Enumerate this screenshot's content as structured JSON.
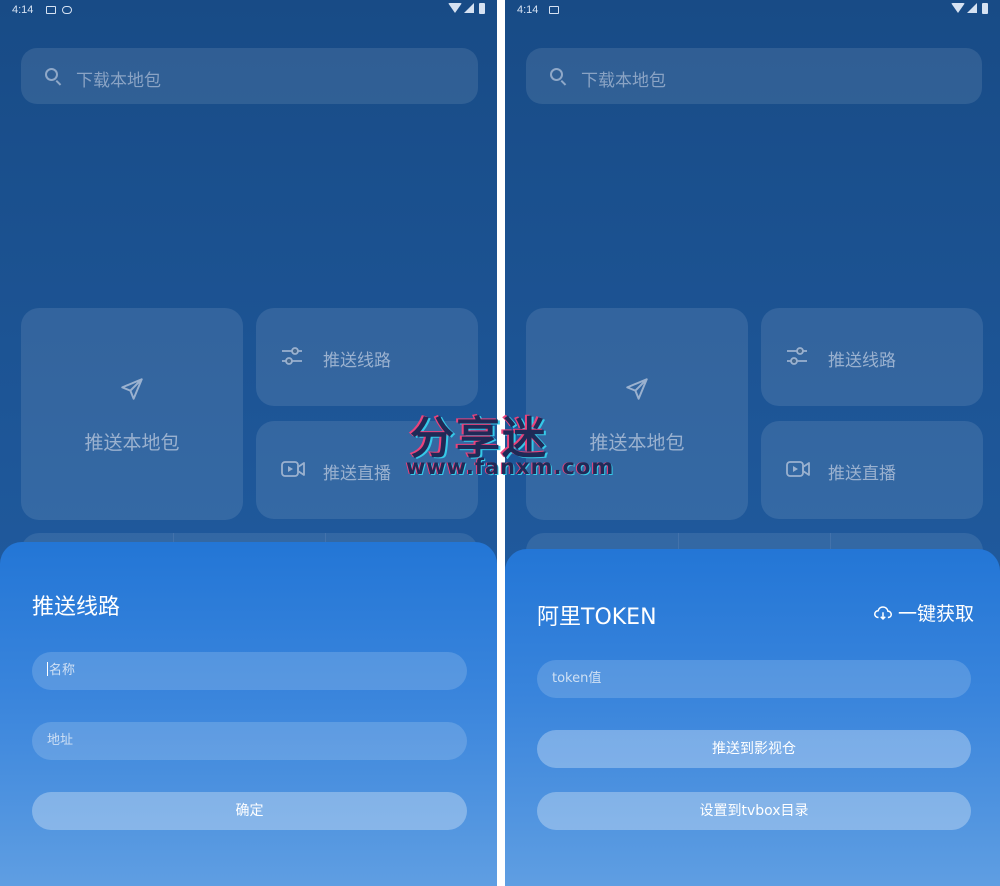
{
  "status_bar": {
    "time": "4:14"
  },
  "search": {
    "placeholder": "下载本地包"
  },
  "tiles": {
    "push_local": "推送本地包",
    "push_route": "推送线路",
    "push_live": "推送直播"
  },
  "left_sheet": {
    "title": "推送线路",
    "name_placeholder": "名称",
    "address_placeholder": "地址",
    "confirm_label": "确定"
  },
  "right_sheet": {
    "title": "阿里TOKEN",
    "one_click_label": "一键获取",
    "token_placeholder": "token值",
    "push_to_cinema_label": "推送到影视仓",
    "set_tvbox_label": "设置到tvbox目录"
  },
  "watermark": {
    "title": "分享迷",
    "url": "www.fanxm.com"
  },
  "icons": {
    "search": "search-icon",
    "send": "send-icon",
    "sliders": "sliders-icon",
    "video": "video-icon",
    "cloud_download": "cloud-download-icon"
  },
  "colors": {
    "background": "#1d5596",
    "sheet": "#2376d6",
    "accent_text": "#ffffff"
  }
}
